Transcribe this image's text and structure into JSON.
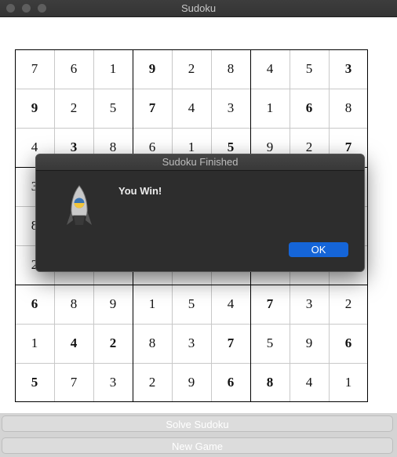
{
  "window": {
    "title": "Sudoku"
  },
  "board": [
    [
      "7",
      "6",
      "1",
      "9",
      "2",
      "8",
      "4",
      "5",
      "3"
    ],
    [
      "9",
      "2",
      "5",
      "7",
      "4",
      "3",
      "1",
      "6",
      "8"
    ],
    [
      "4",
      "3",
      "8",
      "6",
      "1",
      "5",
      "9",
      "2",
      "7"
    ],
    [
      "3",
      "",
      "",
      "",
      "",
      "",
      "",
      "",
      ""
    ],
    [
      "8",
      "",
      "",
      "",
      "",
      "",
      "",
      "",
      ""
    ],
    [
      "2",
      "",
      "",
      "",
      "",
      "",
      "",
      "",
      ""
    ],
    [
      "6",
      "8",
      "9",
      "1",
      "5",
      "4",
      "7",
      "3",
      "2"
    ],
    [
      "1",
      "4",
      "2",
      "8",
      "3",
      "7",
      "5",
      "9",
      "6"
    ],
    [
      "5",
      "7",
      "3",
      "2",
      "9",
      "6",
      "8",
      "4",
      "1"
    ]
  ],
  "bold_cells": [
    [
      0,
      3
    ],
    [
      0,
      8
    ],
    [
      1,
      0
    ],
    [
      1,
      3
    ],
    [
      1,
      7
    ],
    [
      2,
      1
    ],
    [
      2,
      5
    ],
    [
      2,
      8
    ],
    [
      6,
      0
    ],
    [
      6,
      6
    ],
    [
      7,
      1
    ],
    [
      7,
      2
    ],
    [
      7,
      5
    ],
    [
      7,
      8
    ],
    [
      8,
      0
    ],
    [
      8,
      5
    ],
    [
      8,
      6
    ]
  ],
  "buttons": {
    "solve": "Solve Sudoku",
    "new_game": "New Game"
  },
  "dialog": {
    "title": "Sudoku Finished",
    "message": "You Win!",
    "ok_label": "OK",
    "icon": "python-rocket-icon"
  },
  "colors": {
    "ok_button": "#1565d8",
    "dialog_bg": "#2d2d2d"
  }
}
